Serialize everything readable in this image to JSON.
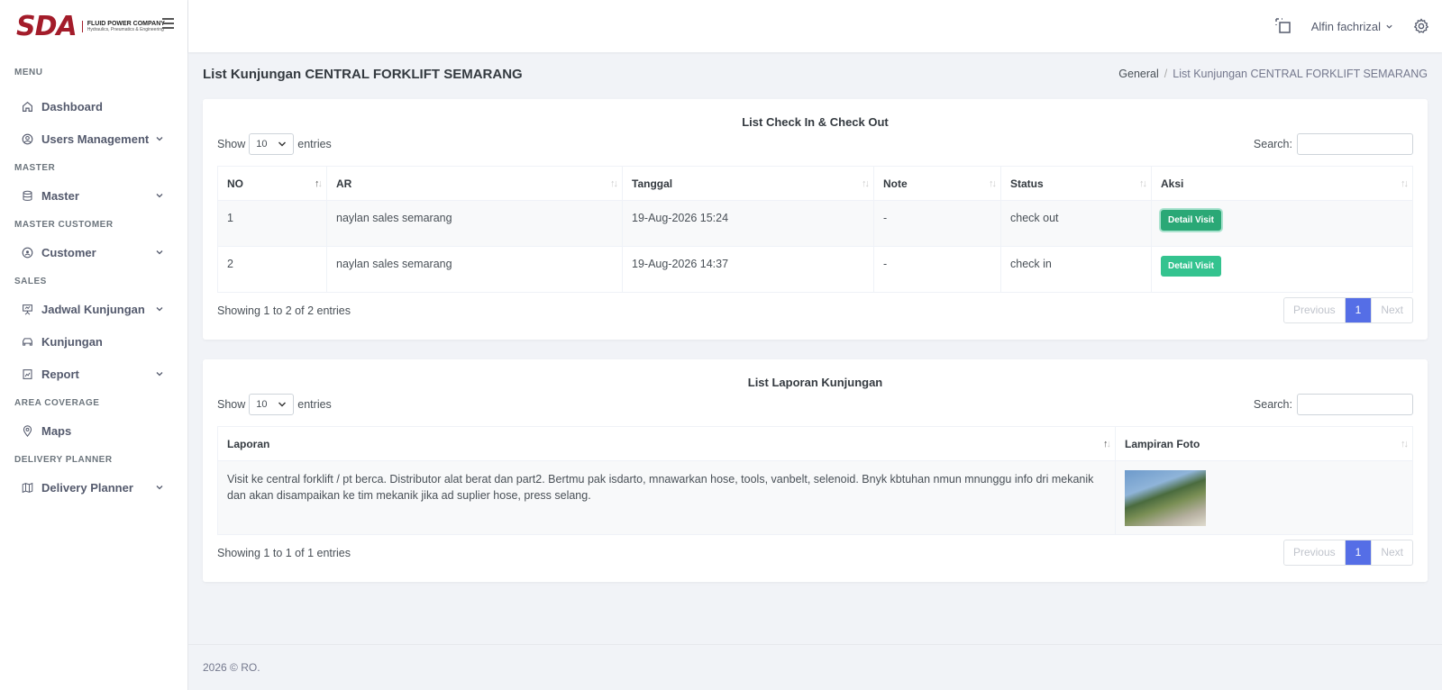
{
  "brand": {
    "logo": "SDA",
    "line1": "FLUID POWER COMPANY",
    "line2": "Hydraulics, Pneumatics & Engineering"
  },
  "sidebar": {
    "sections": [
      {
        "title": "MENU",
        "items": [
          {
            "label": "Dashboard",
            "icon": "home-icon"
          },
          {
            "label": "Users Management",
            "icon": "user-circle-icon",
            "has_children": true
          }
        ]
      },
      {
        "title": "MASTER",
        "items": [
          {
            "label": "Master",
            "icon": "database-icon",
            "has_children": true
          }
        ]
      },
      {
        "title": "MASTER CUSTOMER",
        "items": [
          {
            "label": "Customer",
            "icon": "customer-icon",
            "has_children": true
          }
        ]
      },
      {
        "title": "SALES",
        "items": [
          {
            "label": "Jadwal Kunjungan",
            "icon": "presentation-icon",
            "has_children": true
          },
          {
            "label": "Kunjungan",
            "icon": "car-icon"
          },
          {
            "label": "Report",
            "icon": "report-icon",
            "has_children": true
          }
        ]
      },
      {
        "title": "AREA COVERAGE",
        "items": [
          {
            "label": "Maps",
            "icon": "map-pin-icon"
          }
        ]
      },
      {
        "title": "DELIVERY PLANNER",
        "items": [
          {
            "label": "Delivery Planner",
            "icon": "map-icon",
            "has_children": true
          }
        ]
      }
    ]
  },
  "topbar": {
    "user_name": "Alfin fachrizal"
  },
  "page": {
    "title": "List Kunjungan CENTRAL FORKLIFT SEMARANG",
    "breadcrumb": [
      "General",
      "List Kunjungan CENTRAL FORKLIFT SEMARANG"
    ]
  },
  "checkin_table": {
    "title": "List Check In & Check Out",
    "show_label": "Show",
    "entries_label": "entries",
    "page_size": "10",
    "search_label": "Search:",
    "columns": [
      "NO",
      "AR",
      "Tanggal",
      "Note",
      "Status",
      "Aksi"
    ],
    "rows": [
      {
        "no": "1",
        "ar": "naylan sales semarang",
        "tanggal": "19-Aug-2026 15:24",
        "note": "-",
        "status": "check out",
        "action": "Detail Visit"
      },
      {
        "no": "2",
        "ar": "naylan sales semarang",
        "tanggal": "19-Aug-2026 14:37",
        "note": "-",
        "status": "check in",
        "action": "Detail Visit"
      }
    ],
    "info": "Showing 1 to 2 of 2 entries",
    "pager": {
      "prev": "Previous",
      "current": "1",
      "next": "Next"
    }
  },
  "report_table": {
    "title": "List Laporan Kunjungan",
    "show_label": "Show",
    "entries_label": "entries",
    "page_size": "10",
    "search_label": "Search:",
    "columns": [
      "Laporan",
      "Lampiran Foto"
    ],
    "rows": [
      {
        "laporan": "Visit ke central forklift / pt berca. Distributor alat berat dan part2. Bertmu pak isdarto, mnawarkan hose, tools, vanbelt, selenoid. Bnyk kbtuhan nmun mnunggu info dri mekanik dan akan disampaikan ke tim mekanik jika ad suplier hose, press selang."
      }
    ],
    "info": "Showing 1 to 1 of 1 entries",
    "pager": {
      "prev": "Previous",
      "current": "1",
      "next": "Next"
    }
  },
  "footer": {
    "text": "2026 © RO."
  }
}
